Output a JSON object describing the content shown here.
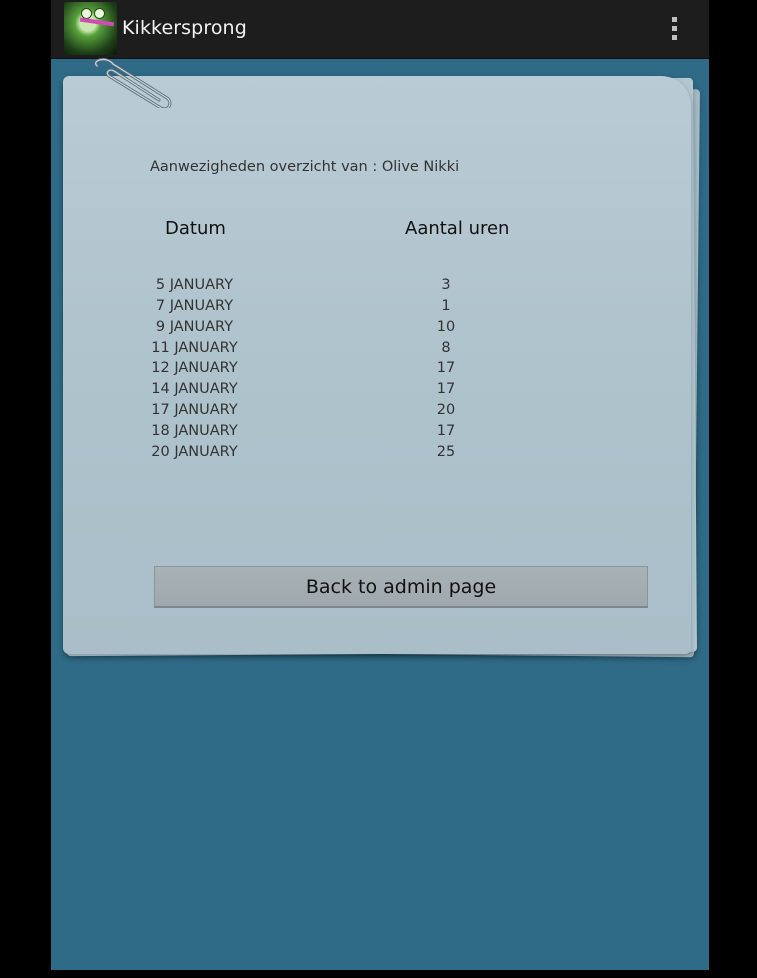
{
  "app": {
    "title": "Kikkersprong"
  },
  "page": {
    "heading": "Aanwezigheden overzicht van : Olive Nikki",
    "columns": {
      "date": "Datum",
      "hours": "Aantal uren"
    },
    "rows": [
      {
        "date": "5 JANUARY",
        "hours": "3"
      },
      {
        "date": "7 JANUARY",
        "hours": "1"
      },
      {
        "date": "9 JANUARY",
        "hours": "10"
      },
      {
        "date": "11 JANUARY",
        "hours": "8"
      },
      {
        "date": "12 JANUARY",
        "hours": "17"
      },
      {
        "date": "14 JANUARY",
        "hours": "17"
      },
      {
        "date": "17 JANUARY",
        "hours": "20"
      },
      {
        "date": "18 JANUARY",
        "hours": "17"
      },
      {
        "date": "20 JANUARY",
        "hours": "25"
      }
    ],
    "back_button_label": "Back to admin page"
  },
  "icons": {
    "app_icon": "frog-app-icon",
    "menu": "overflow-menu-icon",
    "paperclip": "paperclip-icon"
  },
  "colors": {
    "background": "#2f6a86",
    "action_bar": "#1d1d1d",
    "paper": "#b9cbd4",
    "button": "#a8b2b7"
  }
}
